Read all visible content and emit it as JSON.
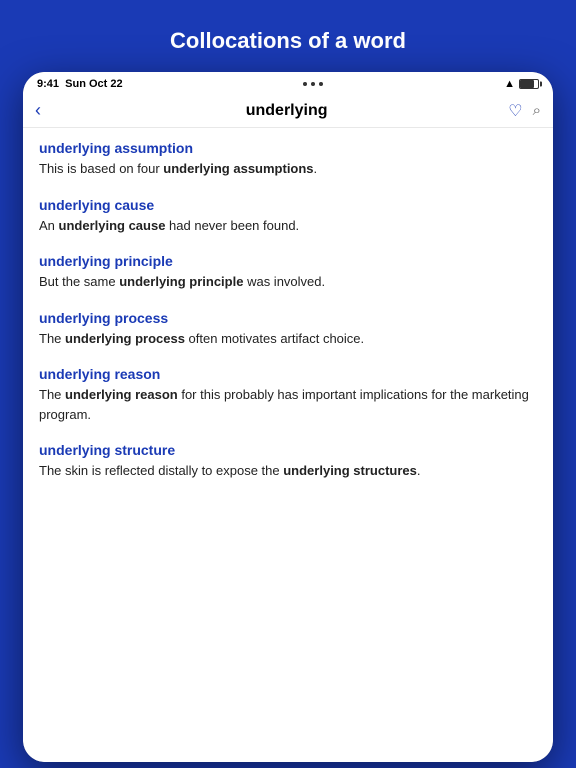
{
  "app": {
    "title": "Collocations of a word"
  },
  "statusBar": {
    "time": "9:41",
    "date": "Sun Oct 22",
    "dots": [
      "•",
      "•",
      "•"
    ]
  },
  "navBar": {
    "back": "‹",
    "searchWord": "underlying",
    "heartLabel": "♡",
    "searchLabel": "⌕"
  },
  "collocations": [
    {
      "id": "assumption",
      "title": "underlying assumption",
      "example": "This is based on four",
      "boldPart": "underlying assumptions",
      "suffix": "."
    },
    {
      "id": "cause",
      "title": "underlying cause",
      "example": "An",
      "boldPart": "underlying cause",
      "suffix": " had never been found."
    },
    {
      "id": "principle",
      "title": "underlying principle",
      "example": "But the same",
      "boldPart": "underlying principle",
      "suffix": " was involved."
    },
    {
      "id": "process",
      "title": "underlying process",
      "example": "The",
      "boldPart": "underlying process",
      "suffix": " often motivates artifact choice."
    },
    {
      "id": "reason",
      "title": "underlying reason",
      "example": "The",
      "boldPart": "underlying reason",
      "suffix": " for this probably has important implications for the marketing program."
    },
    {
      "id": "structure",
      "title": "underlying structure",
      "example": "The skin is reflected distally to expose the",
      "boldPart": "underlying structures",
      "suffix": "."
    }
  ]
}
